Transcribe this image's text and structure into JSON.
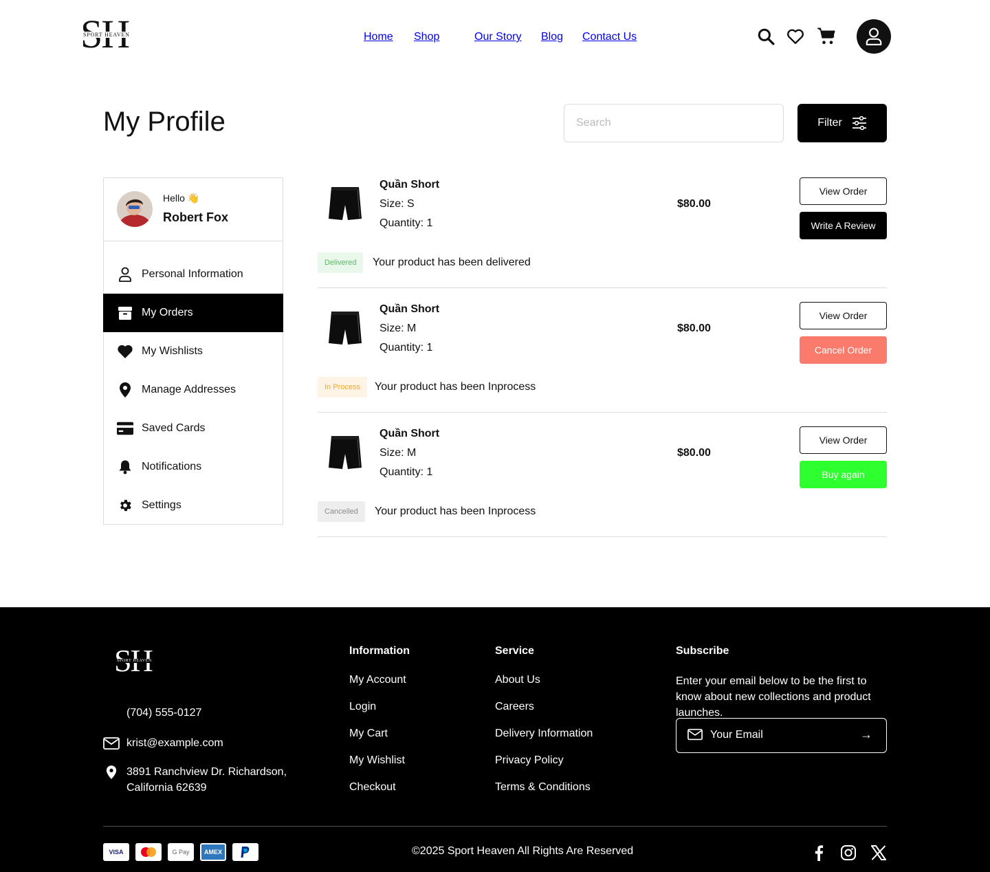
{
  "brand": {
    "logo_big": "SH",
    "logo_small": "SPORT HEAVEN"
  },
  "nav": {
    "home": "Home",
    "shop": "Shop",
    "our_story": "Our Story",
    "blog": "Blog",
    "contact": "Contact Us"
  },
  "header_icons": [
    "search-icon",
    "heart-icon",
    "cart-icon",
    "user-icon"
  ],
  "page": {
    "title": "My Profile"
  },
  "search": {
    "placeholder": "Search",
    "value": ""
  },
  "filter": {
    "label": "Filter"
  },
  "profile": {
    "greeting": "Hello 👋",
    "name": "Robert Fox"
  },
  "sidebar": {
    "items": [
      {
        "label": "Personal Information",
        "icon": "user-icon"
      },
      {
        "label": "My Orders",
        "icon": "box-icon",
        "active": true
      },
      {
        "label": "My Wishlists",
        "icon": "heart-icon"
      },
      {
        "label": "Manage Addresses",
        "icon": "location-pin-icon"
      },
      {
        "label": "Saved Cards",
        "icon": "credit-card-icon"
      },
      {
        "label": "Notifications",
        "icon": "bell-icon"
      },
      {
        "label": "Settings",
        "icon": "gear-icon"
      }
    ]
  },
  "orders": [
    {
      "name": "Quần Short",
      "size": "Size: S",
      "qty": "Quantity: 1",
      "price": "$80.00",
      "view_label": "View Order",
      "action_label": "Write A Review",
      "action_color": "#000000",
      "badge": "Delivered",
      "badge_color": "#4cc35a",
      "badge_bg": "#eaf8ec",
      "status": "Your product has been delivered"
    },
    {
      "name": "Quần Short",
      "size": "Size: M",
      "qty": "Quantity: 1",
      "price": "$80.00",
      "view_label": "View Order",
      "action_label": "Cancel Order",
      "action_color": "#fa7a6b",
      "badge": "In Process",
      "badge_color": "#f0a72a",
      "badge_bg": "#fdf4e6",
      "status": "Your product has been Inprocess"
    },
    {
      "name": "Quần Short",
      "size": "Size: M",
      "qty": "Quantity: 1",
      "price": "$80.00",
      "view_label": "View Order",
      "action_label": "Buy again",
      "action_color": "#2eff2e",
      "badge": "Cancelled",
      "badge_color": "#8a8a8a",
      "badge_bg": "#eeeeee",
      "status": "Your product has been Inprocess"
    }
  ],
  "footer": {
    "phone": "(704) 555-0127",
    "email": "krist@example.com",
    "address_line1": "3891 Ranchview Dr. Richardson,",
    "address_line2": "California 62639",
    "information": {
      "title": "Information",
      "links": [
        "My Account",
        "Login",
        "My Cart",
        "My Wishlist",
        "Checkout"
      ]
    },
    "service": {
      "title": "Service",
      "links": [
        "About Us",
        "Careers",
        "Delivery Information",
        "Privacy Policy",
        "Terms & Conditions"
      ]
    },
    "subscribe": {
      "title": "Subscribe",
      "text": "Enter your email below to be the first to know about new collections and product launches.",
      "placeholder": "Your Email",
      "arrow": "→"
    },
    "payments": [
      "VISA",
      "mastercard",
      "G Pay",
      "AMEX",
      "PayPal"
    ],
    "copyright": "©2025 Sport Heaven  All Rights Are Reserved",
    "social": [
      "facebook-icon",
      "instagram-icon",
      "x-icon"
    ]
  }
}
